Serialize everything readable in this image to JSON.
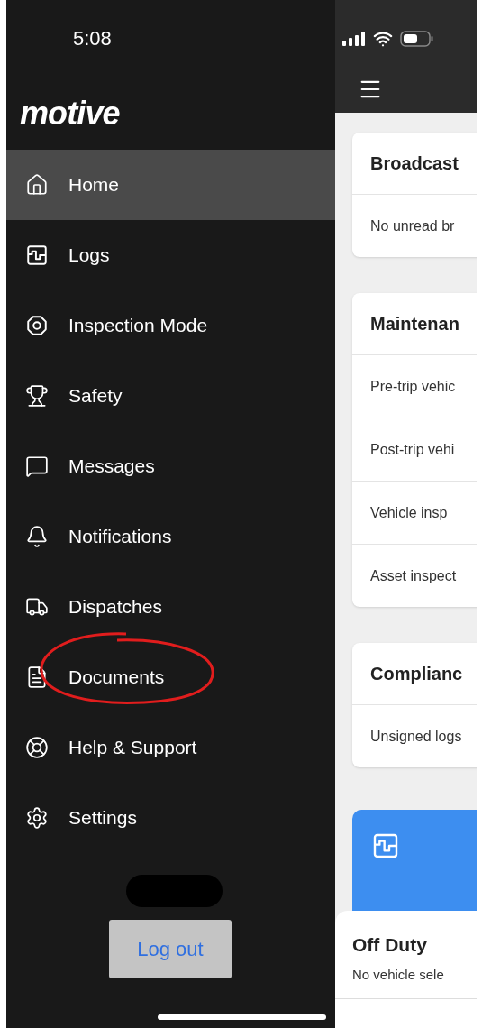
{
  "status_bar": {
    "time": "5:08"
  },
  "sidebar": {
    "logo": "motive",
    "items": [
      {
        "label": "Home",
        "kind": "home",
        "selected": true
      },
      {
        "label": "Logs",
        "kind": "logs",
        "selected": false
      },
      {
        "label": "Inspection Mode",
        "kind": "inspection",
        "selected": false
      },
      {
        "label": "Safety",
        "kind": "safety",
        "selected": false
      },
      {
        "label": "Messages",
        "kind": "messages",
        "selected": false
      },
      {
        "label": "Notifications",
        "kind": "notifications",
        "selected": false
      },
      {
        "label": "Dispatches",
        "kind": "dispatches",
        "selected": false
      },
      {
        "label": "Documents",
        "kind": "documents",
        "selected": false,
        "annotated": true
      },
      {
        "label": "Help & Support",
        "kind": "help",
        "selected": false
      },
      {
        "label": "Settings",
        "kind": "settings",
        "selected": false
      }
    ],
    "logout": "Log out"
  },
  "cards": [
    {
      "title": "Broadcast",
      "rows": [
        "No unread br"
      ]
    },
    {
      "title": "Maintenan",
      "rows": [
        "Pre-trip vehic",
        "Post-trip vehi",
        "Vehicle insp",
        "Asset inspect"
      ]
    },
    {
      "title": "Complianc",
      "rows": [
        "Unsigned logs"
      ]
    }
  ],
  "duty_sheet": {
    "title": "Off Duty",
    "subtitle": "No vehicle sele"
  }
}
